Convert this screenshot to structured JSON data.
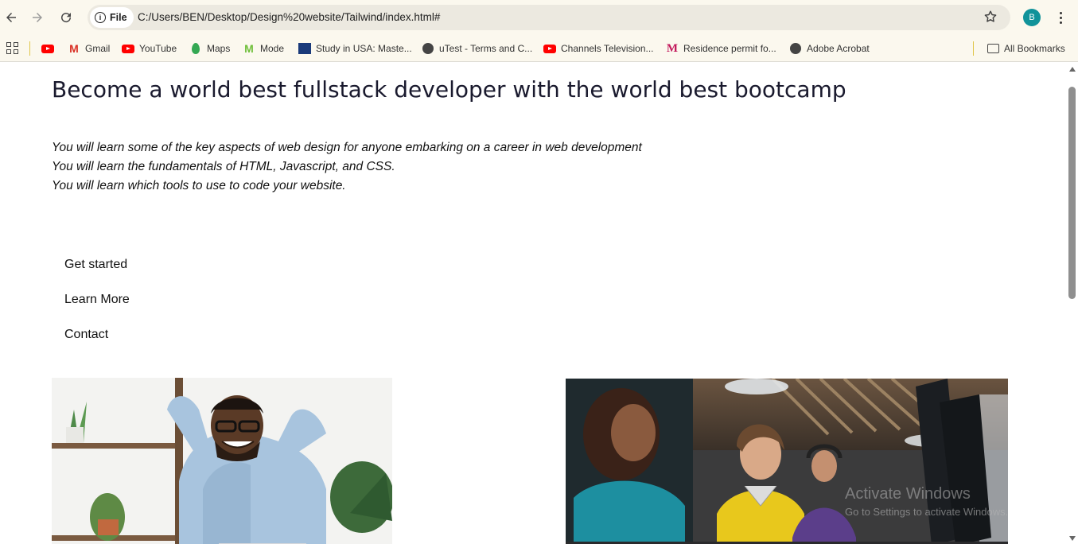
{
  "browser": {
    "site_chip_label": "File",
    "url": "C:/Users/BEN/Desktop/Design%20website/Tailwind/index.html#",
    "profile_initial": "B",
    "profile_color": "#11939a"
  },
  "bookmarks": {
    "items": [
      {
        "label": "",
        "icon": "youtube-icon"
      },
      {
        "label": "Gmail",
        "icon": "gmail-icon"
      },
      {
        "label": "YouTube",
        "icon": "youtube-icon"
      },
      {
        "label": "Maps",
        "icon": "maps-icon"
      },
      {
        "label": "Mode",
        "icon": "mode-icon"
      },
      {
        "label": "Study in USA: Maste...",
        "icon": "study-icon"
      },
      {
        "label": "uTest - Terms and C...",
        "icon": "globe-icon"
      },
      {
        "label": "Channels Television...",
        "icon": "youtube-icon"
      },
      {
        "label": "Residence permit fo...",
        "icon": "m-icon"
      },
      {
        "label": "Adobe Acrobat",
        "icon": "globe-icon"
      }
    ],
    "all_bookmarks_label": "All Bookmarks"
  },
  "page": {
    "title": "Become a world best fullstack developer with the world best bootcamp",
    "points": [
      "You will learn some of the key aspects of web design for anyone embarking on a career in web development",
      "You will learn the fundamentals of HTML, Javascript, and CSS.",
      "You will learn which tools to use to code your website."
    ],
    "menu": [
      "Get started",
      "Learn More",
      "Contact"
    ]
  },
  "os_watermark": {
    "line1": "Activate Windows",
    "line2": "Go to Settings to activate Windows."
  }
}
